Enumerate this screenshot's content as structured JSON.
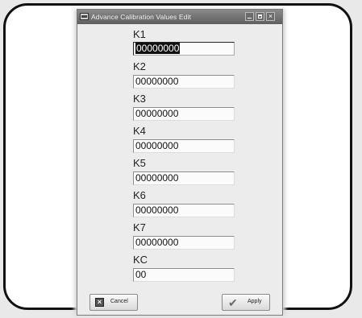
{
  "window": {
    "title": "Advance Calibration Values Edit"
  },
  "fields": [
    {
      "label": "K1",
      "value": "00000000"
    },
    {
      "label": "K2",
      "value": "00000000"
    },
    {
      "label": "K3",
      "value": "00000000"
    },
    {
      "label": "K4",
      "value": "00000000"
    },
    {
      "label": "K5",
      "value": "00000000"
    },
    {
      "label": "K6",
      "value": "00000000"
    },
    {
      "label": "K7",
      "value": "00000000"
    },
    {
      "label": "KC",
      "value": "00"
    }
  ],
  "buttons": {
    "cancel_label": "Cancel",
    "apply_label": "Apply"
  },
  "icons": {
    "app": "app-window-icon",
    "minimize": "minimize-icon",
    "maximize": "maximize-icon",
    "close": "close-icon",
    "cancel": "cancel-x-icon",
    "apply": "checkmark-icon"
  }
}
